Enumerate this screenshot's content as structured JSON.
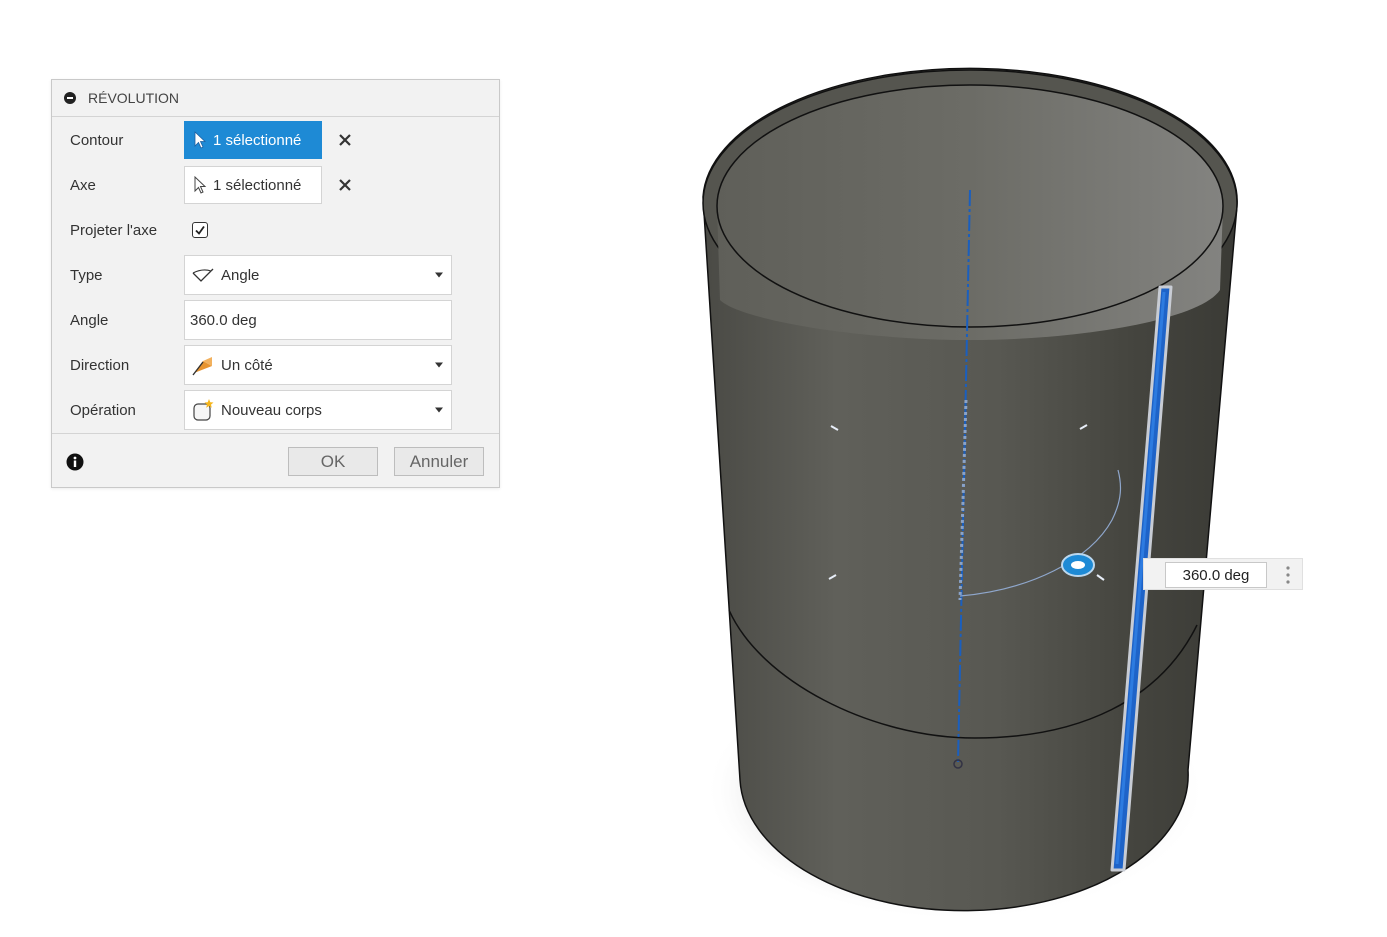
{
  "dialog": {
    "title": "RÉVOLUTION",
    "rows": {
      "contour": {
        "label": "Contour",
        "value": "1 sélectionné"
      },
      "axe": {
        "label": "Axe",
        "value": "1 sélectionné"
      },
      "projeter": {
        "label": "Projeter l'axe",
        "checked": true
      },
      "type": {
        "label": "Type",
        "value": "Angle",
        "icon": "angle-type-icon"
      },
      "angle": {
        "label": "Angle",
        "value": "360.0 deg"
      },
      "direction": {
        "label": "Direction",
        "value": "Un côté",
        "icon": "one-side-direction-icon"
      },
      "operation": {
        "label": "Opération",
        "value": "Nouveau corps",
        "icon": "new-body-icon"
      }
    },
    "buttons": {
      "ok": "OK",
      "cancel": "Annuler"
    }
  },
  "viewport": {
    "angle_input": "360.0 deg",
    "model": "hollow-cylinder",
    "accent": "#1e8ad5",
    "body_color": "#5a5a54",
    "axis_color": "#1a5fbf"
  }
}
